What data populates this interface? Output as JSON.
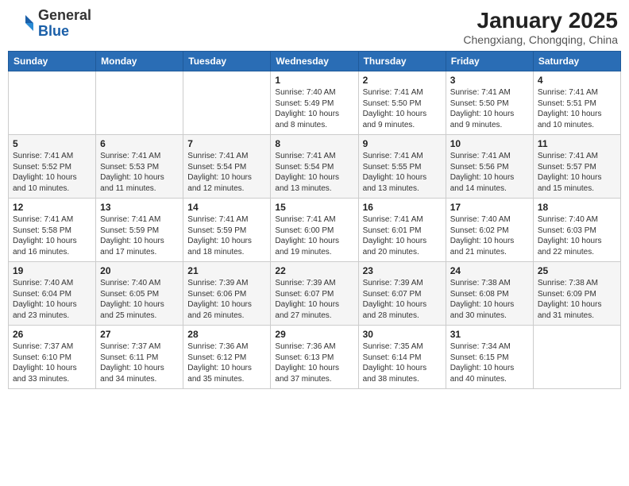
{
  "header": {
    "logo_general": "General",
    "logo_blue": "Blue",
    "month": "January 2025",
    "location": "Chengxiang, Chongqing, China"
  },
  "weekdays": [
    "Sunday",
    "Monday",
    "Tuesday",
    "Wednesday",
    "Thursday",
    "Friday",
    "Saturday"
  ],
  "weeks": [
    [
      {
        "day": "",
        "info": ""
      },
      {
        "day": "",
        "info": ""
      },
      {
        "day": "",
        "info": ""
      },
      {
        "day": "1",
        "info": "Sunrise: 7:40 AM\nSunset: 5:49 PM\nDaylight: 10 hours\nand 8 minutes."
      },
      {
        "day": "2",
        "info": "Sunrise: 7:41 AM\nSunset: 5:50 PM\nDaylight: 10 hours\nand 9 minutes."
      },
      {
        "day": "3",
        "info": "Sunrise: 7:41 AM\nSunset: 5:50 PM\nDaylight: 10 hours\nand 9 minutes."
      },
      {
        "day": "4",
        "info": "Sunrise: 7:41 AM\nSunset: 5:51 PM\nDaylight: 10 hours\nand 10 minutes."
      }
    ],
    [
      {
        "day": "5",
        "info": "Sunrise: 7:41 AM\nSunset: 5:52 PM\nDaylight: 10 hours\nand 10 minutes."
      },
      {
        "day": "6",
        "info": "Sunrise: 7:41 AM\nSunset: 5:53 PM\nDaylight: 10 hours\nand 11 minutes."
      },
      {
        "day": "7",
        "info": "Sunrise: 7:41 AM\nSunset: 5:54 PM\nDaylight: 10 hours\nand 12 minutes."
      },
      {
        "day": "8",
        "info": "Sunrise: 7:41 AM\nSunset: 5:54 PM\nDaylight: 10 hours\nand 13 minutes."
      },
      {
        "day": "9",
        "info": "Sunrise: 7:41 AM\nSunset: 5:55 PM\nDaylight: 10 hours\nand 13 minutes."
      },
      {
        "day": "10",
        "info": "Sunrise: 7:41 AM\nSunset: 5:56 PM\nDaylight: 10 hours\nand 14 minutes."
      },
      {
        "day": "11",
        "info": "Sunrise: 7:41 AM\nSunset: 5:57 PM\nDaylight: 10 hours\nand 15 minutes."
      }
    ],
    [
      {
        "day": "12",
        "info": "Sunrise: 7:41 AM\nSunset: 5:58 PM\nDaylight: 10 hours\nand 16 minutes."
      },
      {
        "day": "13",
        "info": "Sunrise: 7:41 AM\nSunset: 5:59 PM\nDaylight: 10 hours\nand 17 minutes."
      },
      {
        "day": "14",
        "info": "Sunrise: 7:41 AM\nSunset: 5:59 PM\nDaylight: 10 hours\nand 18 minutes."
      },
      {
        "day": "15",
        "info": "Sunrise: 7:41 AM\nSunset: 6:00 PM\nDaylight: 10 hours\nand 19 minutes."
      },
      {
        "day": "16",
        "info": "Sunrise: 7:41 AM\nSunset: 6:01 PM\nDaylight: 10 hours\nand 20 minutes."
      },
      {
        "day": "17",
        "info": "Sunrise: 7:40 AM\nSunset: 6:02 PM\nDaylight: 10 hours\nand 21 minutes."
      },
      {
        "day": "18",
        "info": "Sunrise: 7:40 AM\nSunset: 6:03 PM\nDaylight: 10 hours\nand 22 minutes."
      }
    ],
    [
      {
        "day": "19",
        "info": "Sunrise: 7:40 AM\nSunset: 6:04 PM\nDaylight: 10 hours\nand 23 minutes."
      },
      {
        "day": "20",
        "info": "Sunrise: 7:40 AM\nSunset: 6:05 PM\nDaylight: 10 hours\nand 25 minutes."
      },
      {
        "day": "21",
        "info": "Sunrise: 7:39 AM\nSunset: 6:06 PM\nDaylight: 10 hours\nand 26 minutes."
      },
      {
        "day": "22",
        "info": "Sunrise: 7:39 AM\nSunset: 6:07 PM\nDaylight: 10 hours\nand 27 minutes."
      },
      {
        "day": "23",
        "info": "Sunrise: 7:39 AM\nSunset: 6:07 PM\nDaylight: 10 hours\nand 28 minutes."
      },
      {
        "day": "24",
        "info": "Sunrise: 7:38 AM\nSunset: 6:08 PM\nDaylight: 10 hours\nand 30 minutes."
      },
      {
        "day": "25",
        "info": "Sunrise: 7:38 AM\nSunset: 6:09 PM\nDaylight: 10 hours\nand 31 minutes."
      }
    ],
    [
      {
        "day": "26",
        "info": "Sunrise: 7:37 AM\nSunset: 6:10 PM\nDaylight: 10 hours\nand 33 minutes."
      },
      {
        "day": "27",
        "info": "Sunrise: 7:37 AM\nSunset: 6:11 PM\nDaylight: 10 hours\nand 34 minutes."
      },
      {
        "day": "28",
        "info": "Sunrise: 7:36 AM\nSunset: 6:12 PM\nDaylight: 10 hours\nand 35 minutes."
      },
      {
        "day": "29",
        "info": "Sunrise: 7:36 AM\nSunset: 6:13 PM\nDaylight: 10 hours\nand 37 minutes."
      },
      {
        "day": "30",
        "info": "Sunrise: 7:35 AM\nSunset: 6:14 PM\nDaylight: 10 hours\nand 38 minutes."
      },
      {
        "day": "31",
        "info": "Sunrise: 7:34 AM\nSunset: 6:15 PM\nDaylight: 10 hours\nand 40 minutes."
      },
      {
        "day": "",
        "info": ""
      }
    ]
  ]
}
